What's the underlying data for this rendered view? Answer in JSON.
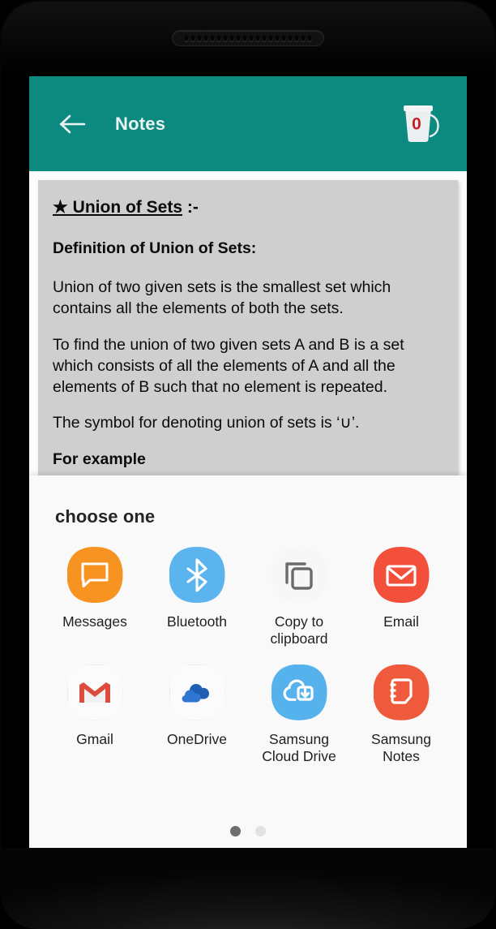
{
  "appbar": {
    "back_icon": "arrow-left-icon",
    "title": "Notes",
    "bin_icon": "trash-bin-icon",
    "bin_count": "0",
    "bg_color": "#0c8a80",
    "count_color": "#c62026"
  },
  "note": {
    "heading": "★ Union of Sets",
    "heading_suffix": " :-",
    "definition_label": "Definition of Union of Sets:",
    "para1": "Union of two given sets is the smallest set which contains all the elements of both the sets.",
    "para2": "To find the union of two given sets A and B is a set which consists of all the elements of A and all the elements of B such that no element is repeated.",
    "para3": "The symbol for denoting union of sets is ‘∪’.",
    "para4": "For example"
  },
  "sheet": {
    "title": "choose one",
    "apps": [
      {
        "label": "Messages",
        "icon": "messages-icon",
        "color": "#f79421"
      },
      {
        "label": "Bluetooth",
        "icon": "bluetooth-icon",
        "color": "#5cb4ef"
      },
      {
        "label": "Copy to clipboard",
        "icon": "copy-to-clipboard-icon",
        "color": "#f7f7f7"
      },
      {
        "label": "Email",
        "icon": "email-icon",
        "color": "#f3503c"
      },
      {
        "label": "Gmail",
        "icon": "gmail-icon",
        "color": "#fbfbfb"
      },
      {
        "label": "OneDrive",
        "icon": "onedrive-icon",
        "color": "#fbfbfb"
      },
      {
        "label": "Samsung Cloud Drive",
        "icon": "samsung-cloud-drive-icon",
        "color": "#55b2ec"
      },
      {
        "label": "Samsung Notes",
        "icon": "samsung-notes-icon",
        "color": "#f05a3c"
      }
    ],
    "pages": [
      {
        "active": true
      },
      {
        "active": false
      }
    ]
  }
}
